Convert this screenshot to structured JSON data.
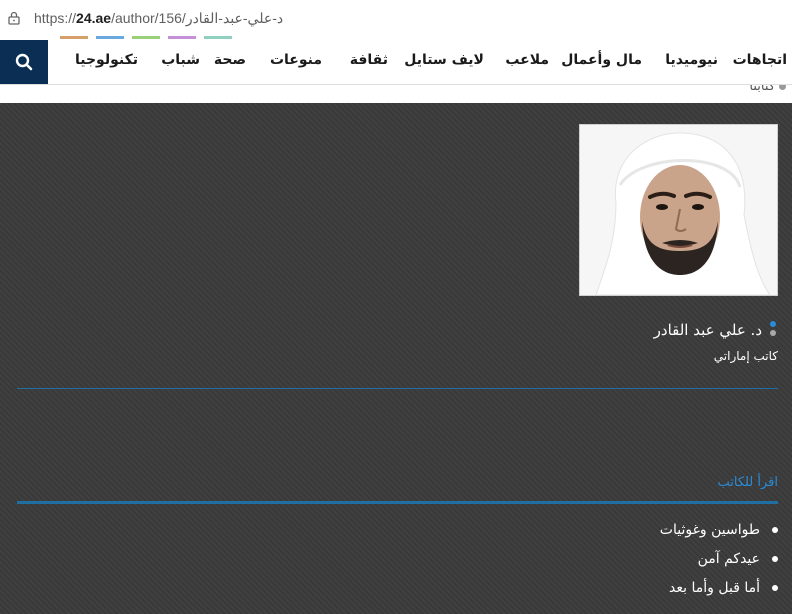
{
  "browser": {
    "url_prefix": "https://",
    "url_domain": "24.ae",
    "url_path": "/author/156/د-علي-عبد-القادر"
  },
  "nav": {
    "items": [
      "اتجاهات",
      "نيوميديا",
      "مال وأعمال",
      "ملاعب",
      "لايف ستايل",
      "ثقافة",
      "منوعات",
      "صحة",
      "شباب",
      "تكنولوجيا"
    ],
    "search_icon": "search-icon"
  },
  "breadcrumb": {
    "label": "كتابنا"
  },
  "author": {
    "name": "د. علي عبد القادر",
    "role": "كاتب إماراتي"
  },
  "read_section": {
    "title": "اقرأ للكاتب",
    "articles": [
      "طواسين وغوثيات",
      "عيدكم آمن",
      "أما قبل وأما بعد"
    ]
  },
  "colors": {
    "nav_search_bg": "#0b2e55",
    "accent_blue": "#1f6fa3",
    "section_title": "#2a8cd6",
    "page_bg": "#3b3b3b"
  }
}
